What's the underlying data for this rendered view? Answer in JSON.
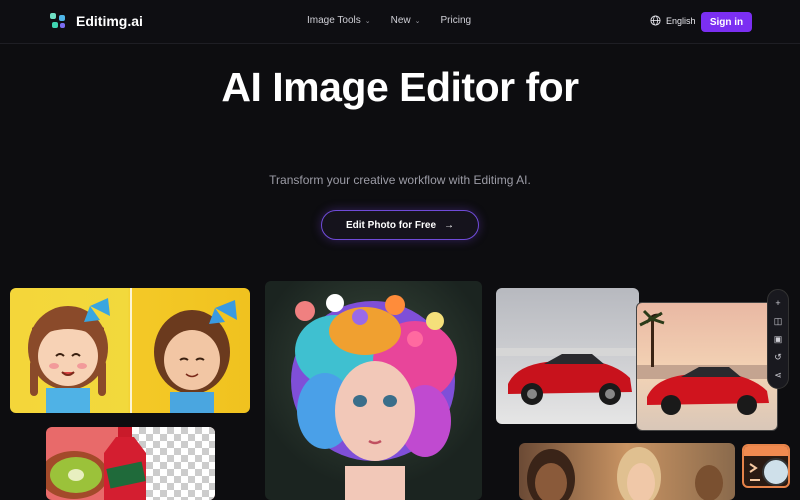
{
  "header": {
    "brand": "Editimg.ai",
    "nav": [
      {
        "label": "Image Tools",
        "has_dropdown": true
      },
      {
        "label": "New",
        "has_dropdown": true
      },
      {
        "label": "Pricing",
        "has_dropdown": false
      }
    ],
    "language": "English",
    "signin_label": "Sign in"
  },
  "hero": {
    "title": "AI Image Editor for",
    "subtitle": "Transform your creative workflow with Editimg AI.",
    "cta_label": "Edit Photo for Free",
    "cta_arrow": "→"
  },
  "toolbar": {
    "icons": [
      "plus-icon",
      "split-icon",
      "image-icon",
      "undo-icon",
      "share-icon"
    ],
    "glyphs": [
      "+",
      "◫",
      "▣",
      "↺",
      "⋖"
    ]
  },
  "colors": {
    "background": "#0d0d10",
    "accent": "#7b2ff2",
    "cta_border": "#6f4bd8",
    "widget_border": "#e6834a"
  }
}
